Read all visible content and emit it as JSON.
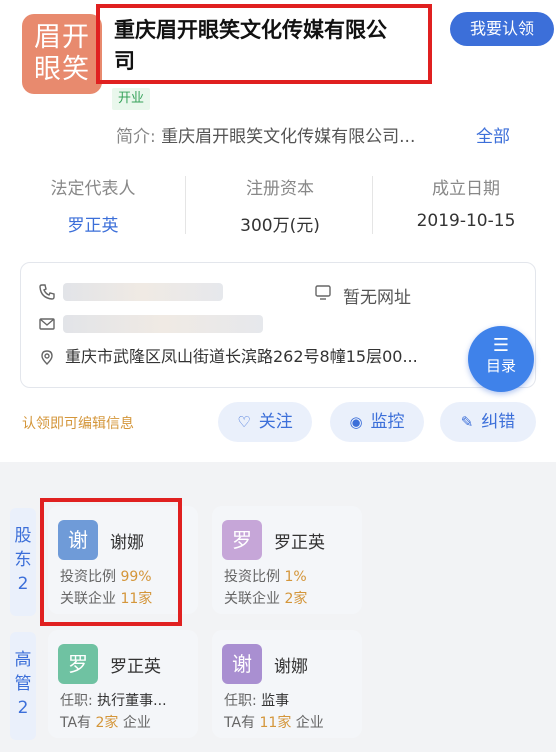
{
  "company": {
    "logo_line1": "眉开",
    "logo_line2": "眼笑",
    "name_line1": "重庆眉开眼笑文化传媒有限公",
    "name_line2": "司",
    "status": "开业",
    "claim_label": "我要认领",
    "intro_label": "简介:",
    "intro_text": "重庆眉开眼笑文化传媒有限公司...",
    "intro_more": "全部"
  },
  "info": {
    "legal_rep_label": "法定代表人",
    "legal_rep_value": "罗正英",
    "capital_label": "注册资本",
    "capital_value": "300万(元)",
    "founded_label": "成立日期",
    "founded_value": "2019-10-15"
  },
  "contact": {
    "website": "暂无网址",
    "address": "重庆市武隆区凤山街道长滨路262号8幢15层00..."
  },
  "toc": {
    "icon": "☰",
    "label": "目录"
  },
  "actions": {
    "edit_hint": "认领即可编辑信息",
    "follow": "关注",
    "monitor": "监控",
    "correct": "纠错"
  },
  "shareholders": {
    "label_chars": [
      "股",
      "东"
    ],
    "count": "2",
    "items": [
      {
        "avatar": "谢",
        "name": "谢娜",
        "ratio_label": "投资比例 ",
        "ratio": "99%",
        "related_label": "关联企业 ",
        "related": "11家"
      },
      {
        "avatar": "罗",
        "name": "罗正英",
        "ratio_label": "投资比例 ",
        "ratio": "1%",
        "related_label": "关联企业 ",
        "related": "2家"
      }
    ]
  },
  "executives": {
    "label_chars": [
      "高",
      "管"
    ],
    "count": "2",
    "items": [
      {
        "avatar": "罗",
        "name": "罗正英",
        "role_label": "任职: ",
        "role": "执行董事...",
        "ta_label": "TA有 ",
        "ta_count": "2家",
        "ta_suffix": " 企业"
      },
      {
        "avatar": "谢",
        "name": "谢娜",
        "role_label": "任职: ",
        "role": "监事",
        "ta_label": "TA有 ",
        "ta_count": "11家",
        "ta_suffix": " 企业"
      }
    ]
  },
  "colors": {
    "accent": "#3c6fd9",
    "highlight": "#d4963a",
    "annotation": "#e02020",
    "logo": "#e88a6e"
  }
}
